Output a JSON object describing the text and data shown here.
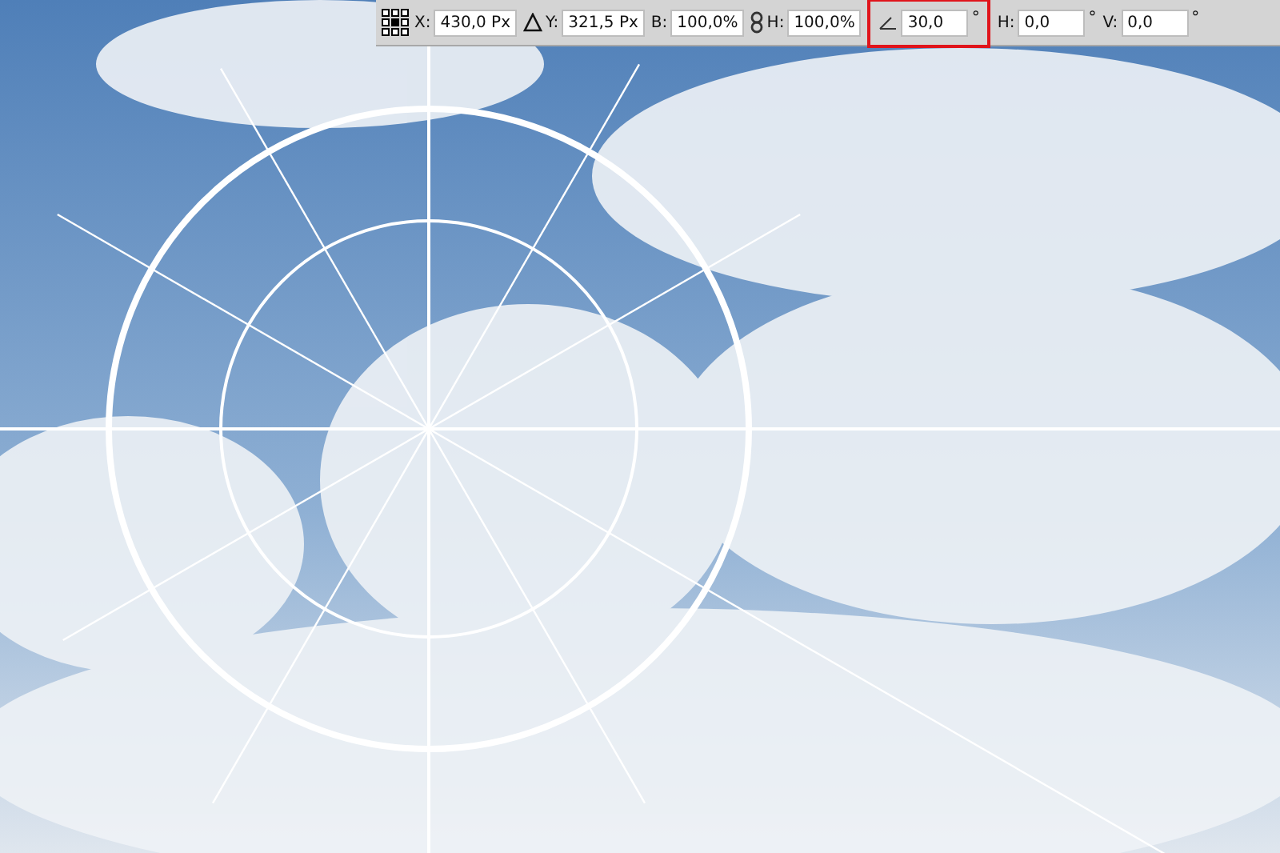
{
  "toolbar": {
    "fields": [
      {
        "label": "X:",
        "value": "430,0 Px",
        "highlighted": false
      },
      {
        "label": "Y:",
        "value": "321,5 Px",
        "highlighted": false
      },
      {
        "label": "B:",
        "value": "100,0%",
        "highlighted": false
      },
      {
        "label": "H:",
        "value": "100,0%",
        "highlighted": false
      },
      {
        "value": "30,0",
        "unit": "°",
        "highlighted": true
      },
      {
        "label": "H:",
        "value": "0,0",
        "unit": "°",
        "highlighted": false
      },
      {
        "label": "V:",
        "value": "0,0",
        "unit": "°",
        "highlighted": false
      }
    ]
  }
}
